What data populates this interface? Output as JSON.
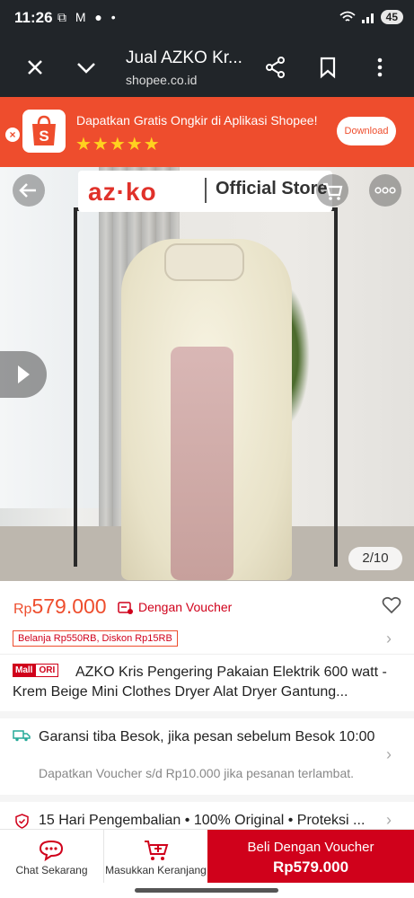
{
  "status": {
    "time": "11:26",
    "left_icons": "⧉ M ● •",
    "right_icons": "📶 .ıl",
    "battery": "45"
  },
  "browser": {
    "title": "Jual AZKO Kr...",
    "url": "shopee.co.id"
  },
  "banner": {
    "text": "Dapatkan Gratis Ongkir di Aplikasi Shopee!",
    "stars": "★★★★★",
    "download_label": "Download",
    "logo_letter": "S"
  },
  "gallery": {
    "brand": "az·ko",
    "store_label": "Official Store",
    "counter": "2/10"
  },
  "product": {
    "currency": "Rp",
    "price": "579.000",
    "voucher_label": "Dengan Voucher",
    "promo": "Belanja Rp550RB, Diskon Rp15RB",
    "mall_badge": "Mall",
    "ori_badge": "ORI",
    "title": "AZKO Kris Pengering Pakaian Elektrik 600 watt - Krem Beige Mini Clothes Dryer Alat Dryer Gantung..."
  },
  "shipping": {
    "line1": "Garansi tiba Besok, jika pesan sebelum Besok 10:00",
    "line2": "Dapatkan Voucher s/d Rp10.000 jika pesanan terlambat."
  },
  "returns": {
    "text": "15 Hari Pengembalian • 100% Original • Proteksi ..."
  },
  "bottom": {
    "chat_label": "Chat Sekarang",
    "cart_label": "Masukkan Keranjang",
    "buy_label": "Beli Dengan Voucher",
    "buy_price": "Rp579.000"
  },
  "colors": {
    "brand": "#ee4d2d",
    "buy": "#d0011b"
  }
}
